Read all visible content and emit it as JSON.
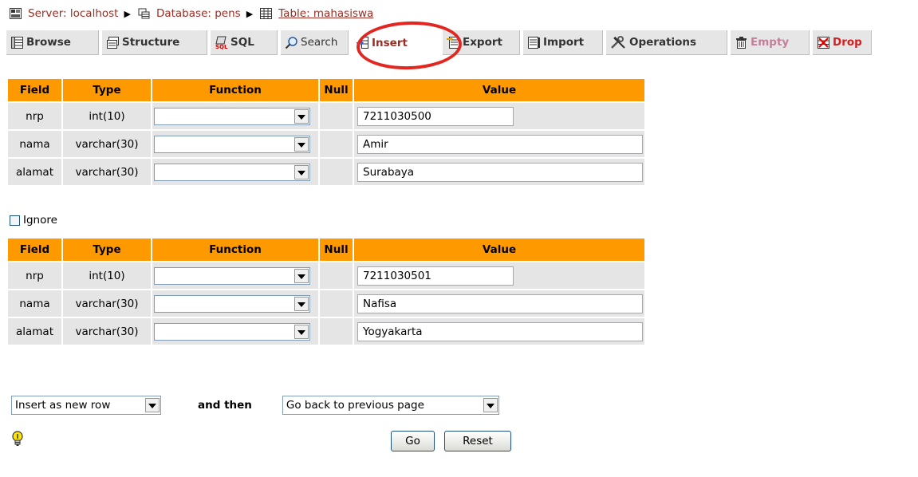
{
  "breadcrumb": {
    "server": "Server: localhost",
    "database": "Database: pens",
    "table": "Table: mahasiswa"
  },
  "tabs": {
    "browse": "Browse",
    "structure": "Structure",
    "sql": "SQL",
    "search": "Search",
    "insert": "Insert",
    "export": "Export",
    "import": "Import",
    "operations": "Operations",
    "empty": "Empty",
    "drop": "Drop"
  },
  "headers": {
    "field": "Field",
    "type": "Type",
    "function": "Function",
    "null": "Null",
    "value": "Value"
  },
  "rows1": [
    {
      "field": "nrp",
      "type": "int(10)",
      "function": "",
      "value": "7211030500"
    },
    {
      "field": "nama",
      "type": "varchar(30)",
      "function": "",
      "value": "Amir"
    },
    {
      "field": "alamat",
      "type": "varchar(30)",
      "function": "",
      "value": "Surabaya"
    }
  ],
  "ignore_label": "Ignore",
  "rows2": [
    {
      "field": "nrp",
      "type": "int(10)",
      "function": "",
      "value": "7211030501"
    },
    {
      "field": "nama",
      "type": "varchar(30)",
      "function": "",
      "value": "Nafisa"
    },
    {
      "field": "alamat",
      "type": "varchar(30)",
      "function": "",
      "value": "Yogyakarta"
    }
  ],
  "bottom": {
    "insert_mode": "Insert as new row",
    "and_then": "and then",
    "after_insert": "Go back to previous page"
  },
  "buttons": {
    "go": "Go",
    "reset": "Reset"
  },
  "colors": {
    "header_bg": "#ff9900",
    "cell_bg": "#e5e5e5",
    "link": "#9b2d23",
    "highlight": "#e3261f"
  }
}
